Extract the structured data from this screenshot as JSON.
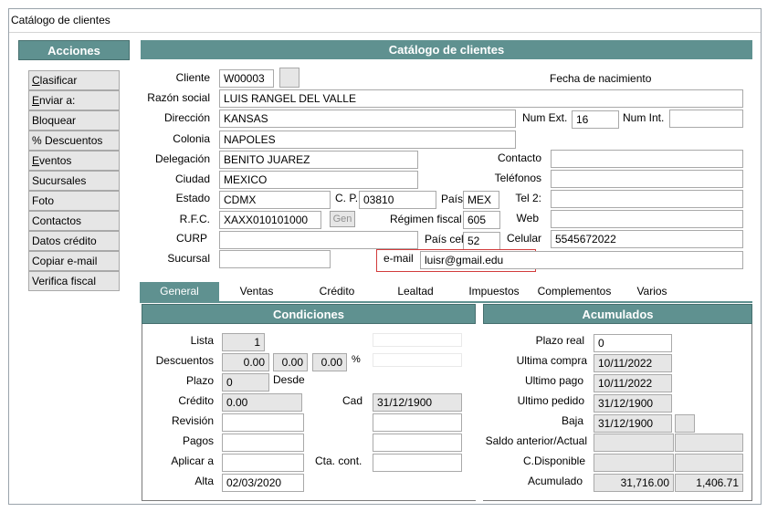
{
  "window": {
    "title": "Catálogo de clientes"
  },
  "sidebar": {
    "header": "Acciones",
    "items": [
      {
        "pre": "",
        "ul": "C",
        "post": "lasificar"
      },
      {
        "pre": "",
        "ul": "E",
        "post": "nviar a:"
      },
      {
        "pre": "Bloquear",
        "ul": "",
        "post": ""
      },
      {
        "pre": "%  Descuentos",
        "ul": "",
        "post": ""
      },
      {
        "pre": "",
        "ul": "E",
        "post": "ventos"
      },
      {
        "pre": "Sucursales",
        "ul": "",
        "post": ""
      },
      {
        "pre": "Foto",
        "ul": "",
        "post": ""
      },
      {
        "pre": "Contactos",
        "ul": "",
        "post": ""
      },
      {
        "pre": "Datos crédito",
        "ul": "",
        "post": ""
      },
      {
        "pre": "Copiar e-mail",
        "ul": "",
        "post": ""
      },
      {
        "pre": "Verifica fiscal",
        "ul": "",
        "post": ""
      }
    ]
  },
  "main": {
    "header": "Catálogo de clientes"
  },
  "form": {
    "cliente": {
      "label": "Cliente",
      "value": "W00003"
    },
    "fecha_nacimiento": {
      "label": "Fecha de nacimiento",
      "value": ""
    },
    "razon_social": {
      "label": "Razón social",
      "value": "LUIS RANGEL DEL VALLE"
    },
    "direccion": {
      "label": "Dirección",
      "value": "KANSAS"
    },
    "num_ext": {
      "label": "Num Ext.",
      "value": "16"
    },
    "num_int": {
      "label": "Num Int.",
      "value": ""
    },
    "colonia": {
      "label": "Colonia",
      "value": "NAPOLES"
    },
    "delegacion": {
      "label": "Delegación",
      "value": "BENITO JUAREZ"
    },
    "contacto": {
      "label": "Contacto",
      "value": ""
    },
    "ciudad": {
      "label": "Ciudad",
      "value": "MEXICO"
    },
    "telefonos": {
      "label": "Teléfonos",
      "value": ""
    },
    "estado": {
      "label": "Estado",
      "value": "CDMX"
    },
    "cp": {
      "label": "C. P.",
      "value": "03810"
    },
    "pais": {
      "label": "País",
      "value": "MEX"
    },
    "tel2": {
      "label": "Tel 2:",
      "value": ""
    },
    "rfc": {
      "label": "R.F.C.",
      "value": "XAXX010101000"
    },
    "gen_button": "Gen",
    "regimen_fiscal": {
      "label": "Régimen fiscal",
      "value": "605"
    },
    "web": {
      "label": "Web",
      "value": ""
    },
    "curp": {
      "label": "CURP",
      "value": ""
    },
    "pais_cel": {
      "label": "País cel",
      "value": "52"
    },
    "celular": {
      "label": "Celular",
      "value": "5545672022"
    },
    "sucursal": {
      "label": "Sucursal",
      "value": ""
    },
    "email": {
      "label": "e-mail",
      "value": "luisr@gmail.edu"
    }
  },
  "tabs": [
    "General",
    "Ventas",
    "Crédito",
    "Lealtad",
    "Impuestos",
    "Complementos",
    "Varios"
  ],
  "condiciones": {
    "header": "Condiciones",
    "lista": {
      "label": "Lista",
      "value": "1"
    },
    "descuentos": {
      "label": "Descuentos",
      "values": [
        "0.00",
        "0.00",
        "0.00"
      ],
      "unit": "%"
    },
    "plazo": {
      "label": "Plazo",
      "value": "0",
      "desde_label": "Desde"
    },
    "credito": {
      "label": "Crédito",
      "value": "0.00"
    },
    "cad": {
      "label": "Cad",
      "value": "31/12/1900"
    },
    "revision": {
      "label": "Revisión",
      "value": ""
    },
    "pagos": {
      "label": "Pagos",
      "value": ""
    },
    "aplicar_a": {
      "label": "Aplicar a",
      "value": ""
    },
    "cta_cont": {
      "label": "Cta. cont.",
      "value": ""
    },
    "alta": {
      "label": "Alta",
      "value": "02/03/2020"
    }
  },
  "acumulados": {
    "header": "Acumulados",
    "plazo_real": {
      "label": "Plazo real",
      "value": "0"
    },
    "ultima_compra": {
      "label": "Ultima compra",
      "value": "10/11/2022"
    },
    "ultimo_pago": {
      "label": "Ultimo pago",
      "value": "10/11/2022"
    },
    "ultimo_pedido": {
      "label": "Ultimo pedido",
      "value": "31/12/1900"
    },
    "baja": {
      "label": "Baja",
      "value": "31/12/1900"
    },
    "saldo": {
      "label": "Saldo anterior/Actual",
      "values": [
        "",
        ""
      ]
    },
    "c_disponible": {
      "label": "C.Disponible",
      "values": [
        "",
        ""
      ]
    },
    "acumulado": {
      "label": "Acumulado",
      "values": [
        "31,716.00",
        "1,406.71"
      ]
    }
  },
  "colors": {
    "header_bg": "#5f9190",
    "email_highlight": "#d23c3c",
    "readonly_bg": "#e6e6e6"
  }
}
